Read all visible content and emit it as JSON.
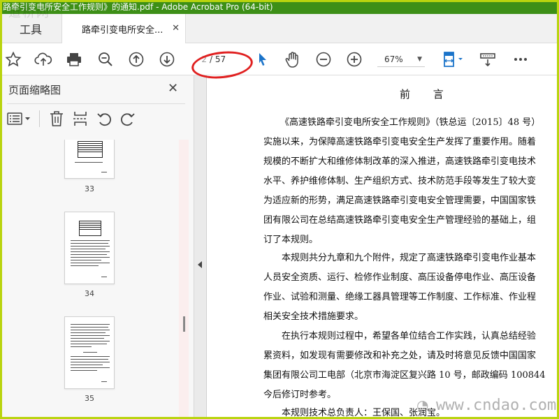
{
  "window": {
    "title": "路牵引变电所安全工作规则》的通知.pdf - Adobe Acrobat Pro (64-bit)",
    "watermark_top": "道桥网",
    "watermark_bottom": "www.cndao.com"
  },
  "tabs": {
    "tools_label": "工具",
    "document_label": "路牵引变电所安全..."
  },
  "toolbar": {
    "current_page": "2",
    "total_pages": "/ 57",
    "zoom": "67%",
    "icons": [
      "star-icon",
      "cloud-upload-icon",
      "printer-icon",
      "zoom-out-search-icon",
      "page-up-icon",
      "page-down-icon",
      "select-cursor-icon",
      "hand-icon",
      "zoom-out-icon",
      "zoom-in-icon",
      "fit-page-icon",
      "comment-tool-icon",
      "more-icon"
    ],
    "accent_color": "#1a73c9",
    "annotation_color": "#e02020"
  },
  "left_panel": {
    "title": "页面缩略图",
    "thumbnails": [
      {
        "label": "33"
      },
      {
        "label": "34"
      },
      {
        "label": "35"
      }
    ]
  },
  "document": {
    "heading": "前  言",
    "lines": [
      "《高速铁路牵引变电所安全工作规则》（铁总运〔2015〕48 号）",
      "实施以来，为保障高速铁路牵引变电安全生产发挥了重要作用。随着",
      "规模的不断扩大和维修体制改革的深入推进，高速铁路牵引变电技术",
      "水平、养护维修体制、生产组织方式、技术防范手段等发生了较大变",
      "为适应新的形势，满足高速铁路牵引变电安全管理需要，中国国家铁",
      "团有限公司在总结高速铁路牵引变电安全生产管理经验的基础上，组",
      "订了本规则。",
      "本规则共分九章和九个附件，规定了高速铁路牵引变电作业基本",
      "人员安全资质、运行、检修作业制度、高压设备停电作业、高压设备",
      "作业、试验和测量、绝缘工器具管理等工作制度、工作标准、作业程",
      "相关安全技术措施要求。",
      "在执行本规则过程中，希望各单位结合工作实践，认真总结经验",
      "累资料，如发现有需要修改和补充之处，请及时将意见反馈中国国家",
      "集团有限公司工电部（北京市海淀区复兴路 10 号，邮政编码 100844",
      "今后修订时参考。",
      "本规则技术总负责人：王保国、张润宝。"
    ]
  }
}
